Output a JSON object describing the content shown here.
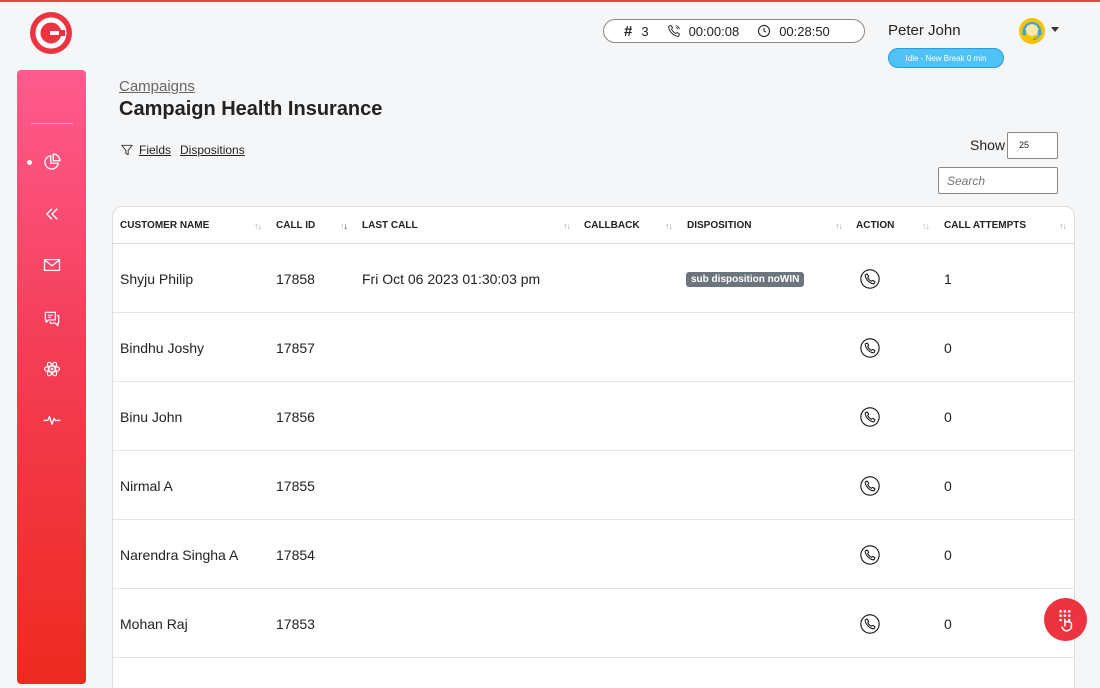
{
  "header": {
    "queue_count": "3",
    "call_timer": "00:00:08",
    "session_timer": "00:28:50",
    "user_name": "Peter John",
    "user_status": "Idle - New Break 0 min"
  },
  "sidebar": {
    "items": [
      "dashboard-icon",
      "collapse-icon",
      "mail-icon",
      "chat-icon",
      "atom-icon",
      "activity-icon"
    ]
  },
  "breadcrumb": "Campaigns",
  "page_title": "Campaign Health Insurance",
  "filters": {
    "fields_label": "Fields",
    "dispositions_label": "Dispositions"
  },
  "show": {
    "label": "Show",
    "value": "25"
  },
  "search": {
    "placeholder": "Search"
  },
  "table": {
    "columns": [
      "CUSTOMER NAME",
      "CALL ID",
      "LAST CALL",
      "CALLBACK",
      "DISPOSITION",
      "ACTION",
      "CALL ATTEMPTS"
    ],
    "rows": [
      {
        "name": "Shyju Philip",
        "call_id": "17858",
        "last_call": "Fri Oct 06 2023 01:30:03 pm",
        "callback": "",
        "disposition": "sub disposition noWIN",
        "attempts": "1"
      },
      {
        "name": "Bindhu Joshy",
        "call_id": "17857",
        "last_call": "",
        "callback": "",
        "disposition": "",
        "attempts": "0"
      },
      {
        "name": "Binu John",
        "call_id": "17856",
        "last_call": "",
        "callback": "",
        "disposition": "",
        "attempts": "0"
      },
      {
        "name": "Nirmal A",
        "call_id": "17855",
        "last_call": "",
        "callback": "",
        "disposition": "",
        "attempts": "0"
      },
      {
        "name": "Narendra Singha A",
        "call_id": "17854",
        "last_call": "",
        "callback": "",
        "disposition": "",
        "attempts": "0"
      },
      {
        "name": "Mohan Raj",
        "call_id": "17853",
        "last_call": "",
        "callback": "",
        "disposition": "",
        "attempts": "0"
      }
    ]
  },
  "colors": {
    "brand": "#ee3340",
    "status_idle": "#4fc3f7",
    "badge": "#6c757d"
  }
}
